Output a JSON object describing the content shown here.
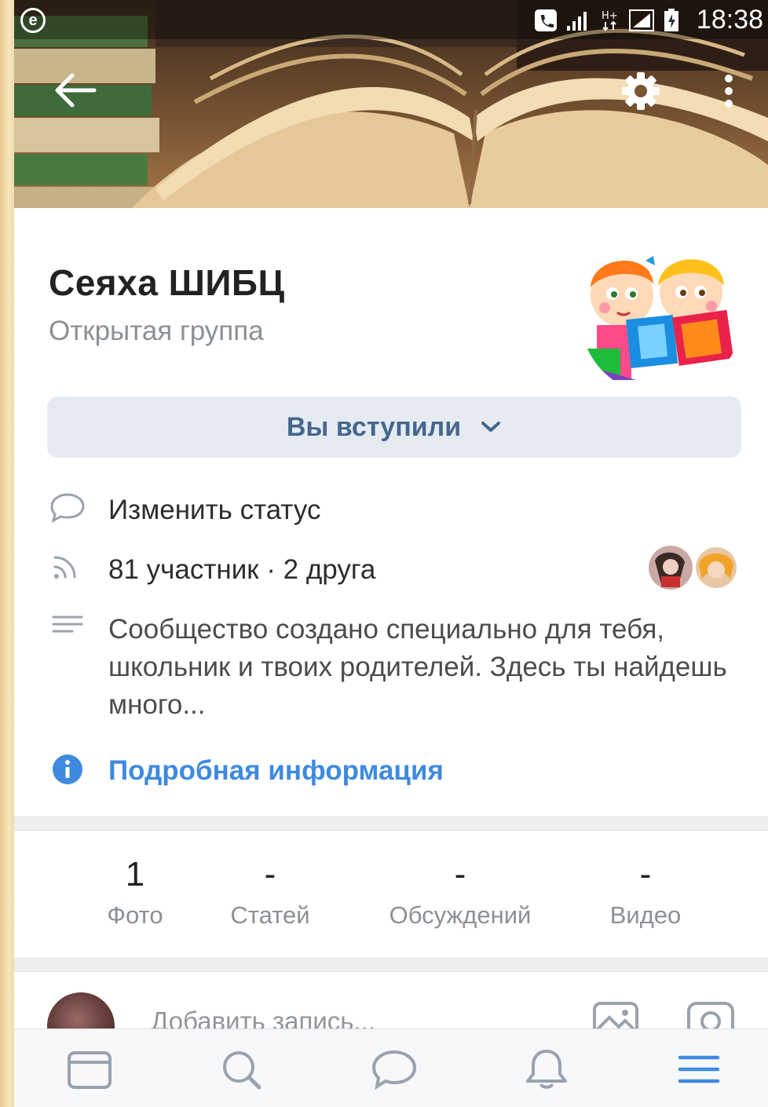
{
  "status_bar": {
    "time": "18:38",
    "left_icon": "e",
    "icons": [
      "phone-icon",
      "signal-icon",
      "data-icon",
      "signal-sim2-icon",
      "battery-icon"
    ]
  },
  "toolbar": {
    "back_icon": "arrow-left-icon",
    "settings_icon": "gear-icon",
    "more_icon": "more-vertical-icon"
  },
  "group": {
    "name": "Сеяха ШИБЦ",
    "type": "Открытая группа",
    "avatar_icon": "group-avatar"
  },
  "join_button": {
    "label": "Вы вступили",
    "icon": "chevron-down-icon"
  },
  "info_rows": {
    "status": {
      "icon": "speech-bubble-icon",
      "text": "Изменить статус"
    },
    "members": {
      "icon": "rss-icon",
      "text": "81 участник · 2 друга"
    },
    "description": {
      "icon": "text-lines-icon",
      "text": "Сообщество создано специально для тебя, школьник и твоих родителей. Здесь ты найдешь много..."
    },
    "details": {
      "icon": "info-icon",
      "text": "Подробная информация"
    }
  },
  "counters": [
    {
      "value": "1",
      "label": "Фото"
    },
    {
      "value": "-",
      "label": "Статей"
    },
    {
      "value": "-",
      "label": "Обсуждений"
    },
    {
      "value": "-",
      "label": "Видео"
    }
  ],
  "composer": {
    "placeholder": "Добавить запись..."
  },
  "tabbar": [
    "news-icon",
    "search-icon",
    "messages-icon",
    "notifications-icon",
    "menu-icon"
  ],
  "colors": {
    "accent": "#3f8ae0",
    "button_bg": "#e5ebf1",
    "button_text": "#45678f",
    "secondary_text": "#8b9094",
    "separator": "#edeef0"
  }
}
